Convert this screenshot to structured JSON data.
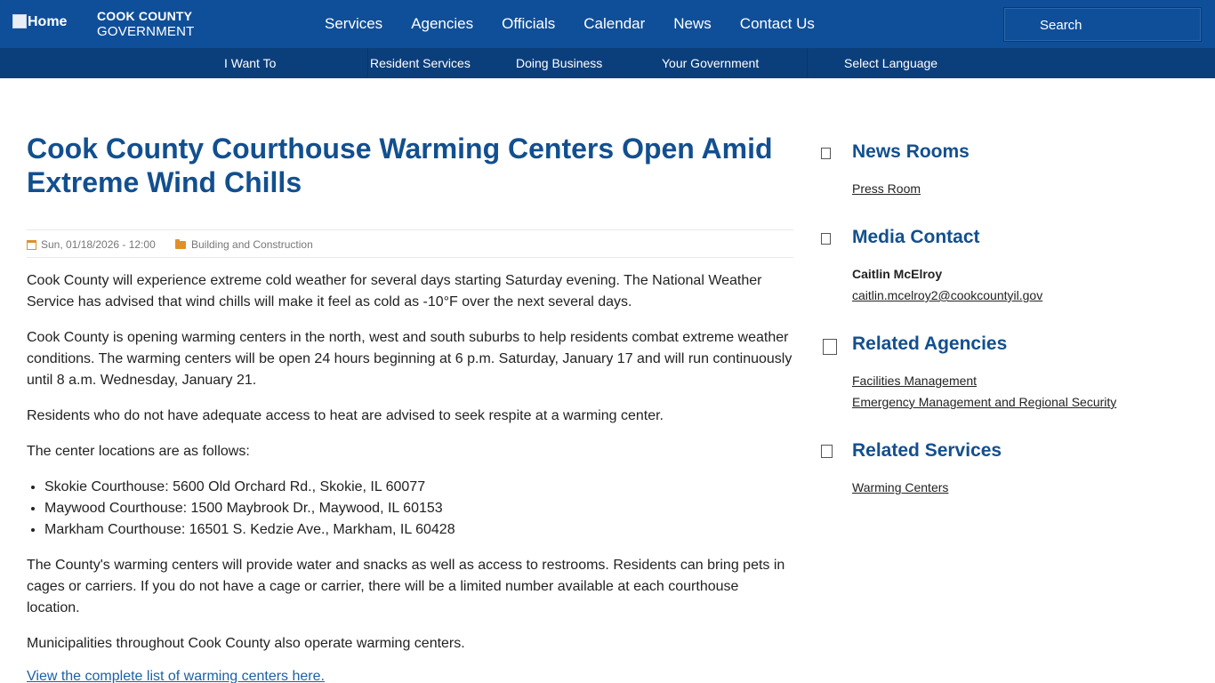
{
  "header": {
    "home_alt": "Home",
    "brand_line1": "COOK COUNTY",
    "brand_line2": "GOVERNMENT",
    "nav": [
      "Services",
      "Agencies",
      "Officials",
      "Calendar",
      "News",
      "Contact Us"
    ],
    "search_placeholder": "Search"
  },
  "subnav": [
    "I Want To",
    "Resident Services",
    "Doing Business",
    "Your Government",
    "Select Language"
  ],
  "article": {
    "title": "Cook County Courthouse Warming Centers Open Amid Extreme Wind Chills",
    "date": "Sun, 01/18/2026 - 12:00",
    "category": "Building and Construction",
    "p1": "Cook County will experience extreme cold weather for several days starting Saturday evening. The National Weather Service has advised that wind chills will make it feel as cold as -10°F over the next several days.",
    "p2": "Cook County is opening warming centers in the north, west and south suburbs to help residents combat extreme weather conditions. The warming centers will  be open 24 hours beginning at 6 p.m. Saturday, January 17 and will run continuously until 8 a.m. Wednesday, January 21.",
    "p3": "Residents who do not have adequate access to heat are advised to seek respite at a warming center.",
    "p4": "The center locations are as follows:",
    "locations": [
      "Skokie Courthouse: 5600 Old Orchard Rd., Skokie, IL 60077",
      "Maywood Courthouse: 1500 Maybrook Dr., Maywood, IL 60153",
      "Markham Courthouse: 16501 S. Kedzie Ave., Markham, IL 60428"
    ],
    "p5": "The County's warming centers will provide water and snacks as well as access to restrooms. Residents can bring pets in cages or carriers. If you do not have a cage or carrier, there will be a limited number available at each courthouse location.",
    "p6": "Municipalities throughout Cook County also operate warming centers.",
    "more_link": "View the complete list of warming centers here."
  },
  "sidebar": {
    "news_rooms": {
      "heading": "News Rooms",
      "links": [
        "Press Room"
      ]
    },
    "media_contact": {
      "heading": "Media Contact",
      "name": "Caitlin McElroy",
      "email": "caitlin.mcelroy2@cookcountyil.gov"
    },
    "related_agencies": {
      "heading": "Related Agencies",
      "links": [
        "Facilities Management",
        "Emergency Management and Regional Security"
      ]
    },
    "related_services": {
      "heading": "Related Services",
      "links": [
        "Warming Centers"
      ]
    }
  }
}
